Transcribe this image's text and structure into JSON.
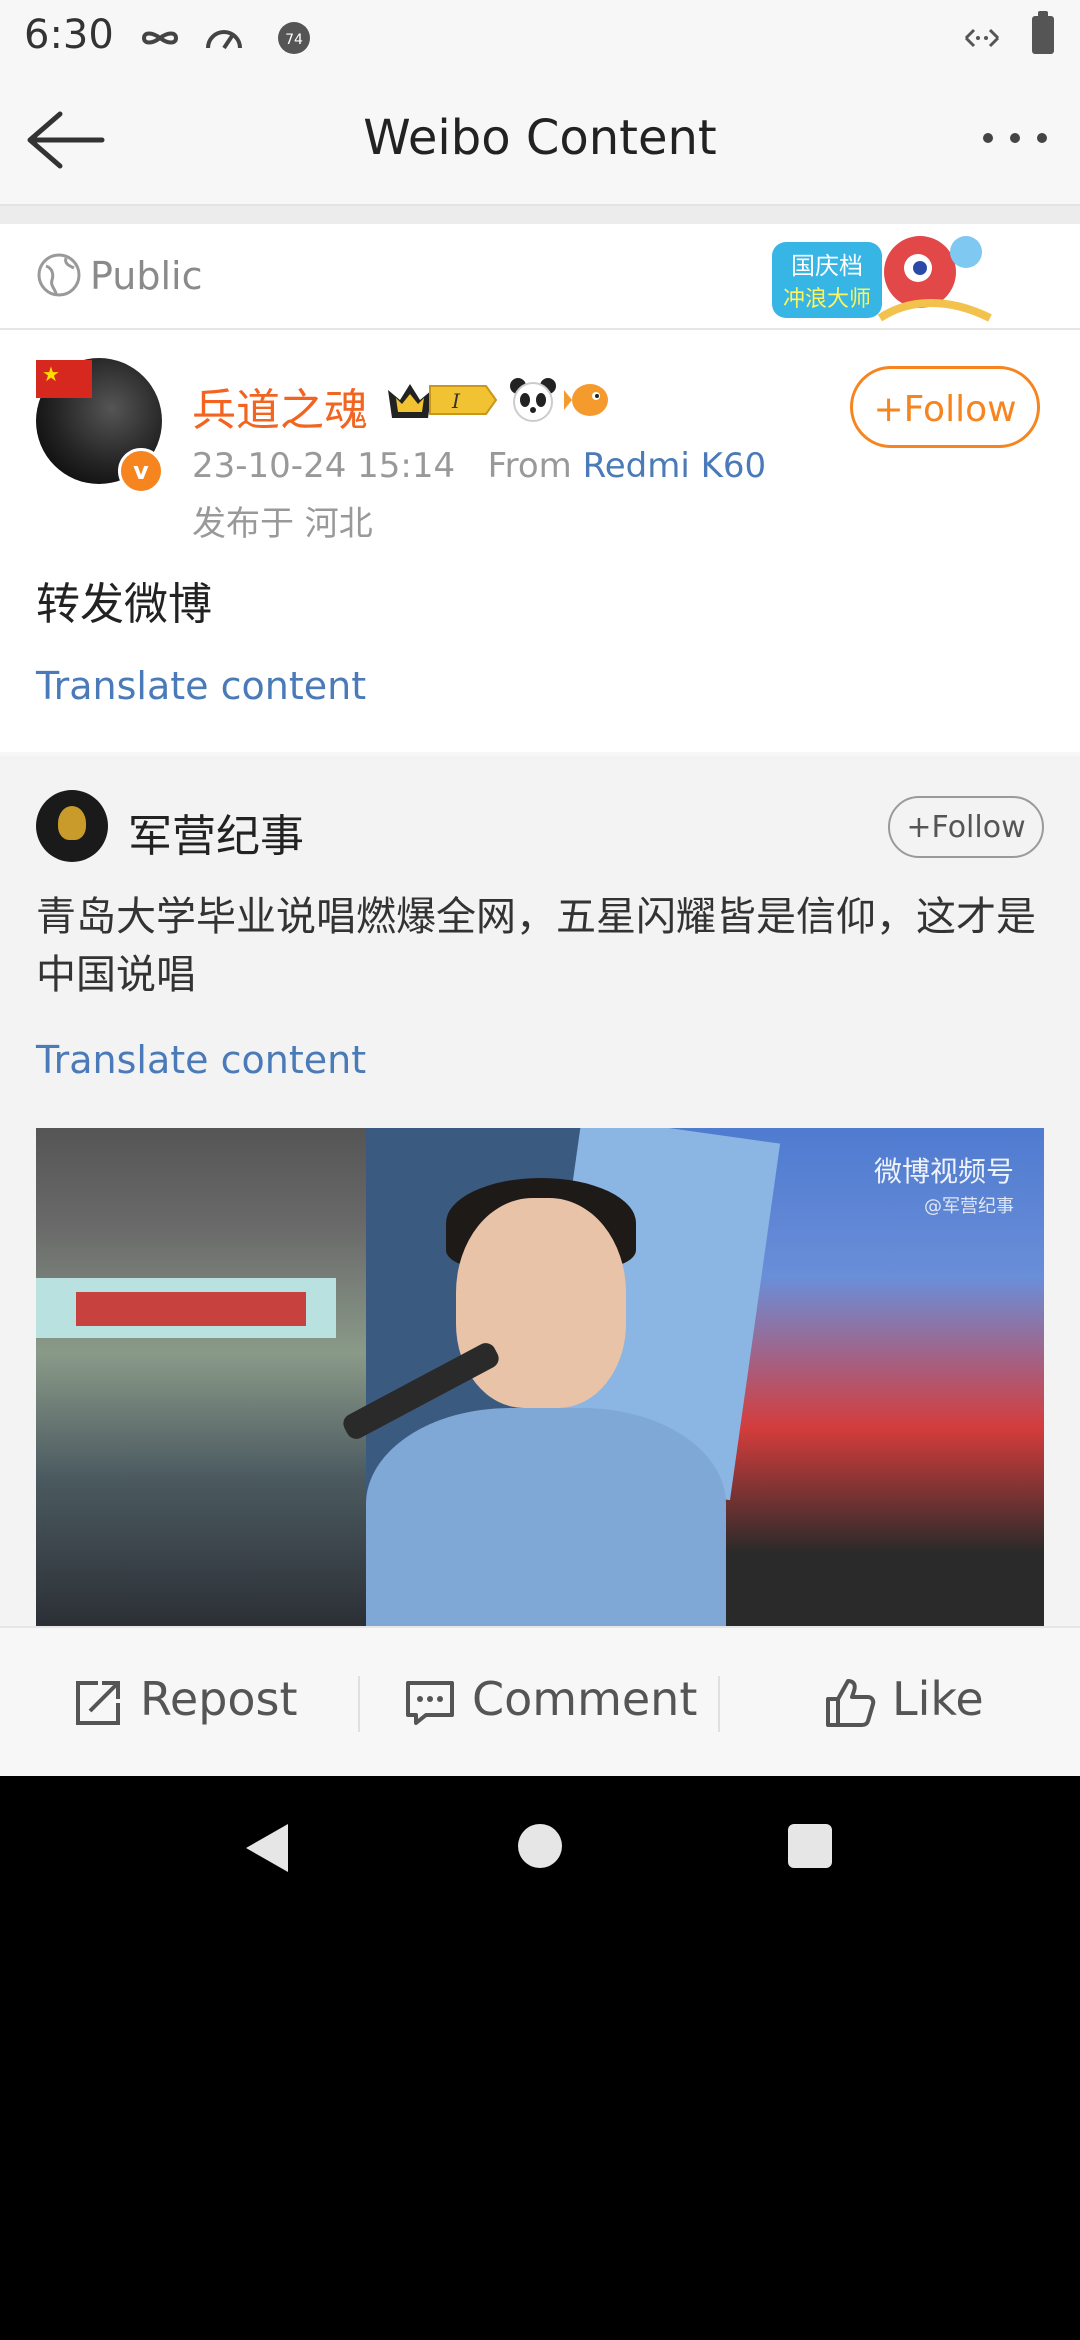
{
  "status_bar": {
    "time": "6:30",
    "icons": [
      "infinity-icon",
      "speedometer-icon",
      "notification-count-icon",
      "data-arrows-icon",
      "battery-icon"
    ]
  },
  "header": {
    "title": "Weibo Content",
    "back_icon": "back-arrow-icon",
    "more_icon": "more-dots-icon"
  },
  "visibility": {
    "label": "Public",
    "icon": "globe-icon",
    "banner_lines": [
      "国庆档",
      "冲浪大师"
    ]
  },
  "post": {
    "username": "兵道之魂",
    "vip_level": "I",
    "follow_label": "Follow",
    "timestamp": "23-10-24 15:14",
    "from_label": "From",
    "device": "Redmi K60",
    "location": "发布于 河北",
    "text": "转发微博",
    "translate_label": "Translate content"
  },
  "repost": {
    "username": "军营纪事",
    "follow_label": "Follow",
    "text": "青岛大学毕业说唱燃爆全网，五星闪耀皆是信仰，这才是中国说唱",
    "translate_label": "Translate content",
    "video_watermark": "微博视频号",
    "video_watermark_sub": "@军营纪事"
  },
  "actions": {
    "repost": "Repost",
    "comment": "Comment",
    "like": "Like"
  },
  "colors": {
    "accent_orange": "#f6841f",
    "link_blue": "#4a7ab8",
    "username_orange": "#f2641f"
  }
}
